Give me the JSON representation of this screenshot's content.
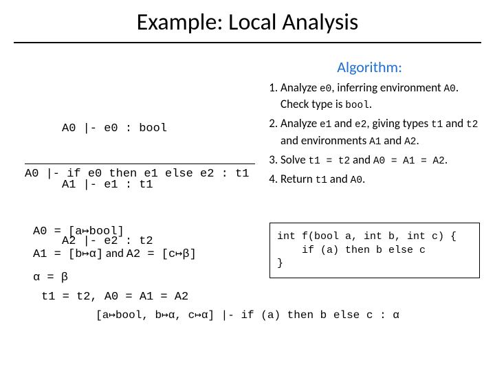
{
  "title": "Example: Local Analysis",
  "algorithm_label": "Algorithm:",
  "premises": {
    "l1": "A0 |- e0 : bool",
    "l2": "A1 |- e1 : t1",
    "l3": "A2 |- e2 : t2",
    "l4": "t1 = t2, A0 = A1 = A2"
  },
  "conclusion": "A0 |- if e0 then e1 else e2 : t1",
  "steps": {
    "s1a": "Analyze ",
    "s1_e0": "e0",
    "s1b": ", inferring environment ",
    "s1_A0": "A0",
    "s1c": ". Check type is ",
    "s1_bool": "bool",
    "s1d": ".",
    "s2a": "Analyze ",
    "s2_e1": "e1",
    "s2b": " and ",
    "s2_e2": "e2",
    "s2c": ", giving types ",
    "s2_t1": "t1",
    "s2d": " and ",
    "s2_t2": "t2",
    "s2e": " and environments ",
    "s2_A1": "A1",
    "s2f": " and ",
    "s2_A2": "A2",
    "s2g": ".",
    "s3a": "Solve ",
    "s3_eq1": "t1 = t2",
    "s3b": " and ",
    "s3_eq2": "A0 = A1 = A2",
    "s3c": ".",
    "s4a": "Return ",
    "s4_t1": "t1",
    "s4b": " and ",
    "s4_A0": "A0",
    "s4c": "."
  },
  "env": {
    "l1a": "A0 = [a↦bool]",
    "l2a": "A1 = [b↦α]",
    "l2_and": " and ",
    "l2b": "A2 = [c↦β]",
    "l3": "α = β"
  },
  "codebox": "int f(bool a, int b, int c) {\n    if (a) then b else c\n}",
  "bottom": "[a↦bool, b↦α, c↦α] |- if (a) then b else c : α"
}
